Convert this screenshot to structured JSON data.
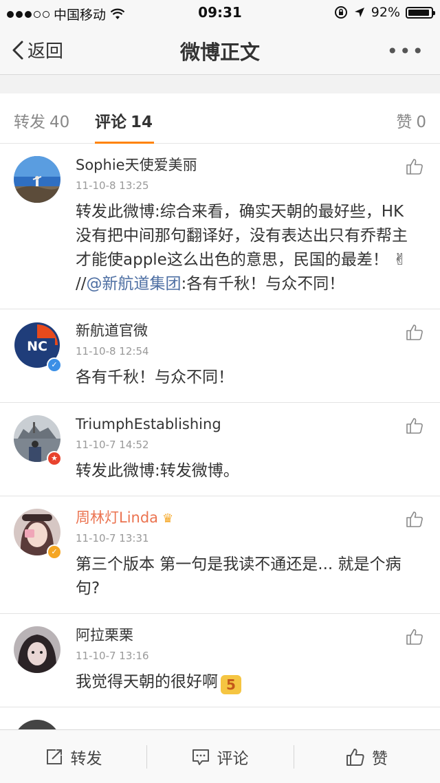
{
  "status_bar": {
    "carrier": "中国移动",
    "time": "09:31",
    "battery": "92%",
    "battery_level": 0.92,
    "signal_bars": 3,
    "signal_total": 5
  },
  "nav": {
    "back_label": "返回",
    "title": "微博正文",
    "more_label": "•••"
  },
  "tabs": {
    "forward_label": "转发",
    "forward_count": "40",
    "comment_label": "评论",
    "comment_count": "14",
    "like_label": "赞",
    "like_count": "0",
    "accent_color": "#ff8200"
  },
  "comments": [
    {
      "name": "Sophie天使爱美丽",
      "time": "11-10-8 13:25",
      "text_before": "转发此微博:综合来看，确实天朝的最好些，HK没有把中间那句翻译好，没有表达出只有乔帮主才能使apple这么出色的意思，民国的最差！ ",
      "emoji": "✌",
      "text_slash": " //",
      "mention": "@新航道集团",
      "text_after": ":各有千秋！与众不同！"
    },
    {
      "name": "新航道官微",
      "time": "11-10-8 12:54",
      "text": "各有千秋！与众不同！",
      "avatar_text": "NC"
    },
    {
      "name": "TriumphEstablishing",
      "time": "11-10-7 14:52",
      "text": "转发此微博:转发微博。"
    },
    {
      "name": "周林灯Linda",
      "time": "11-10-7 13:31",
      "text": "第三个版本 第一句是我读不通还是... 就是个病句?"
    },
    {
      "name": "阿拉栗栗",
      "time": "11-10-7 13:16",
      "text": "我觉得天朝的很好啊",
      "emoji": "5"
    }
  ],
  "toolbar": {
    "forward_label": "转发",
    "comment_label": "评论",
    "like_label": "赞"
  }
}
